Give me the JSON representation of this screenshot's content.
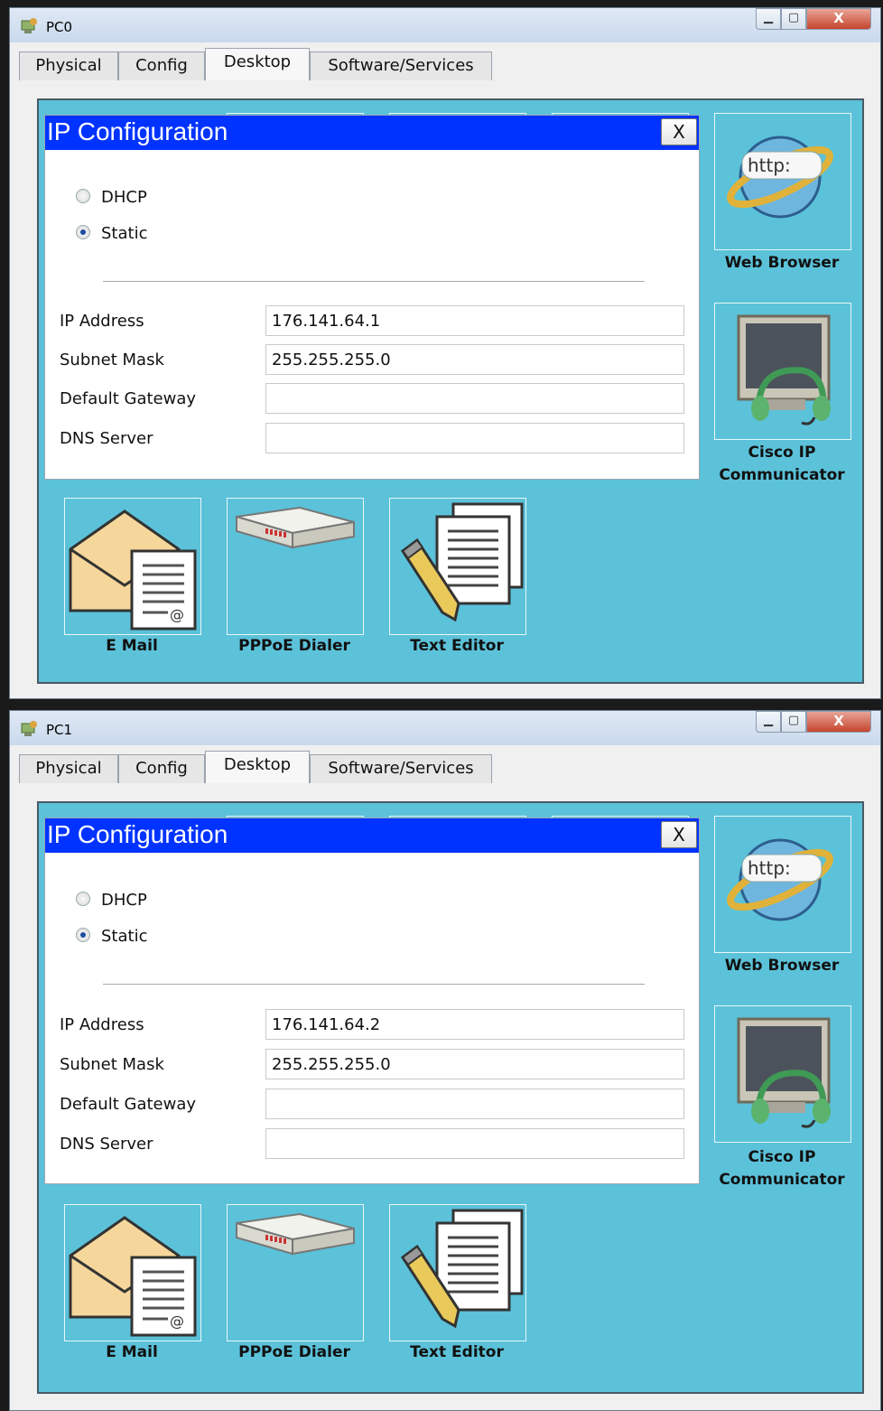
{
  "windows": [
    {
      "title": "PC0",
      "tabs": [
        "Physical",
        "Config",
        "Desktop",
        "Software/Services"
      ],
      "active_tab": "Desktop",
      "dialog": {
        "title": "IP Configuration",
        "close_label": "X",
        "dhcp_label": "DHCP",
        "static_label": "Static",
        "selected_mode": "Static",
        "ip_address_label": "IP Address",
        "ip_address": "176.141.64.1",
        "subnet_mask_label": "Subnet Mask",
        "subnet_mask": "255.255.255.0",
        "default_gateway_label": "Default Gateway",
        "default_gateway": "",
        "dns_server_label": "DNS Server",
        "dns_server": ""
      },
      "apps": {
        "web_browser": "Web Browser",
        "cisco_ip": "Cisco IP",
        "communicator": "Communicator",
        "email": "E Mail",
        "pppoe": "PPPoE Dialer",
        "text_editor": "Text Editor",
        "http_text": "http:"
      }
    },
    {
      "title": "PC1",
      "tabs": [
        "Physical",
        "Config",
        "Desktop",
        "Software/Services"
      ],
      "active_tab": "Desktop",
      "dialog": {
        "title": "IP Configuration",
        "close_label": "X",
        "dhcp_label": "DHCP",
        "static_label": "Static",
        "selected_mode": "Static",
        "ip_address_label": "IP Address",
        "ip_address": "176.141.64.2",
        "subnet_mask_label": "Subnet Mask",
        "subnet_mask": "255.255.255.0",
        "default_gateway_label": "Default Gateway",
        "default_gateway": "",
        "dns_server_label": "DNS Server",
        "dns_server": ""
      },
      "apps": {
        "web_browser": "Web Browser",
        "cisco_ip": "Cisco IP",
        "communicator": "Communicator",
        "email": "E Mail",
        "pppoe": "PPPoE Dialer",
        "text_editor": "Text Editor",
        "http_text": "http:"
      }
    }
  ],
  "colors": {
    "desktop_bg": "#5bc2d9",
    "dialog_title_bg": "#0033ff",
    "close_button": "#c6452f"
  },
  "icons": {
    "title": "packet-tracer-pc-icon",
    "web_browser": "globe-http-icon",
    "ip_communicator": "monitor-headset-icon",
    "email": "envelope-document-icon",
    "pppoe": "dialer-modem-icon",
    "text_editor": "pencil-documents-icon"
  }
}
